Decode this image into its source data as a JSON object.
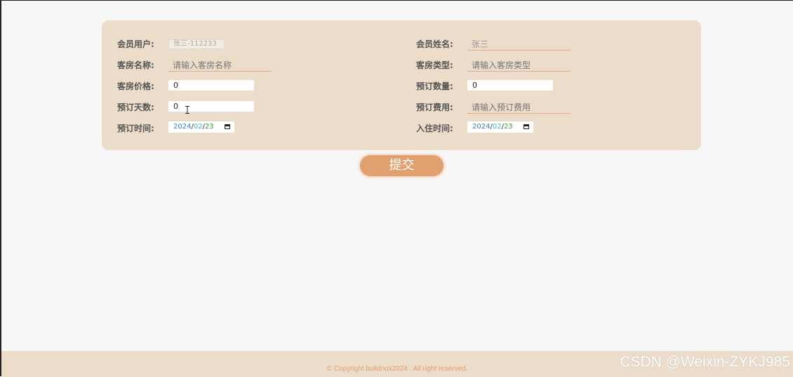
{
  "form": {
    "member_user_label": "会员用户:",
    "member_user_value": "张三-112233",
    "member_name_label": "会员姓名:",
    "member_name_value": "张三",
    "room_name_label": "客房名称:",
    "room_name_placeholder": "请输入客房名称",
    "room_type_label": "客房类型:",
    "room_type_placeholder": "请输入客房类型",
    "room_price_label": "客房价格:",
    "room_price_value": "0",
    "booking_qty_label": "预订数量:",
    "booking_qty_value": "0",
    "booking_days_label": "预订天数:",
    "booking_days_value": "0",
    "booking_fee_label": "预订费用:",
    "booking_fee_placeholder": "请输入预订费用",
    "booking_time_label": "预订时间:",
    "booking_time": {
      "year": "2024",
      "month": "02",
      "day": "23"
    },
    "checkin_time_label": "入住时间:",
    "checkin_time": {
      "year": "2024",
      "month": "02",
      "day": "23"
    }
  },
  "submit_label": "提交",
  "footer": {
    "copyright": "© Copyright buildnox2024 . All right reserved."
  },
  "watermark": "CSDN @Weixin-ZYKJ985",
  "colors": {
    "card_bg": "#ecdcca",
    "accent": "#e0a070",
    "page_bg": "#f7f7f7"
  }
}
